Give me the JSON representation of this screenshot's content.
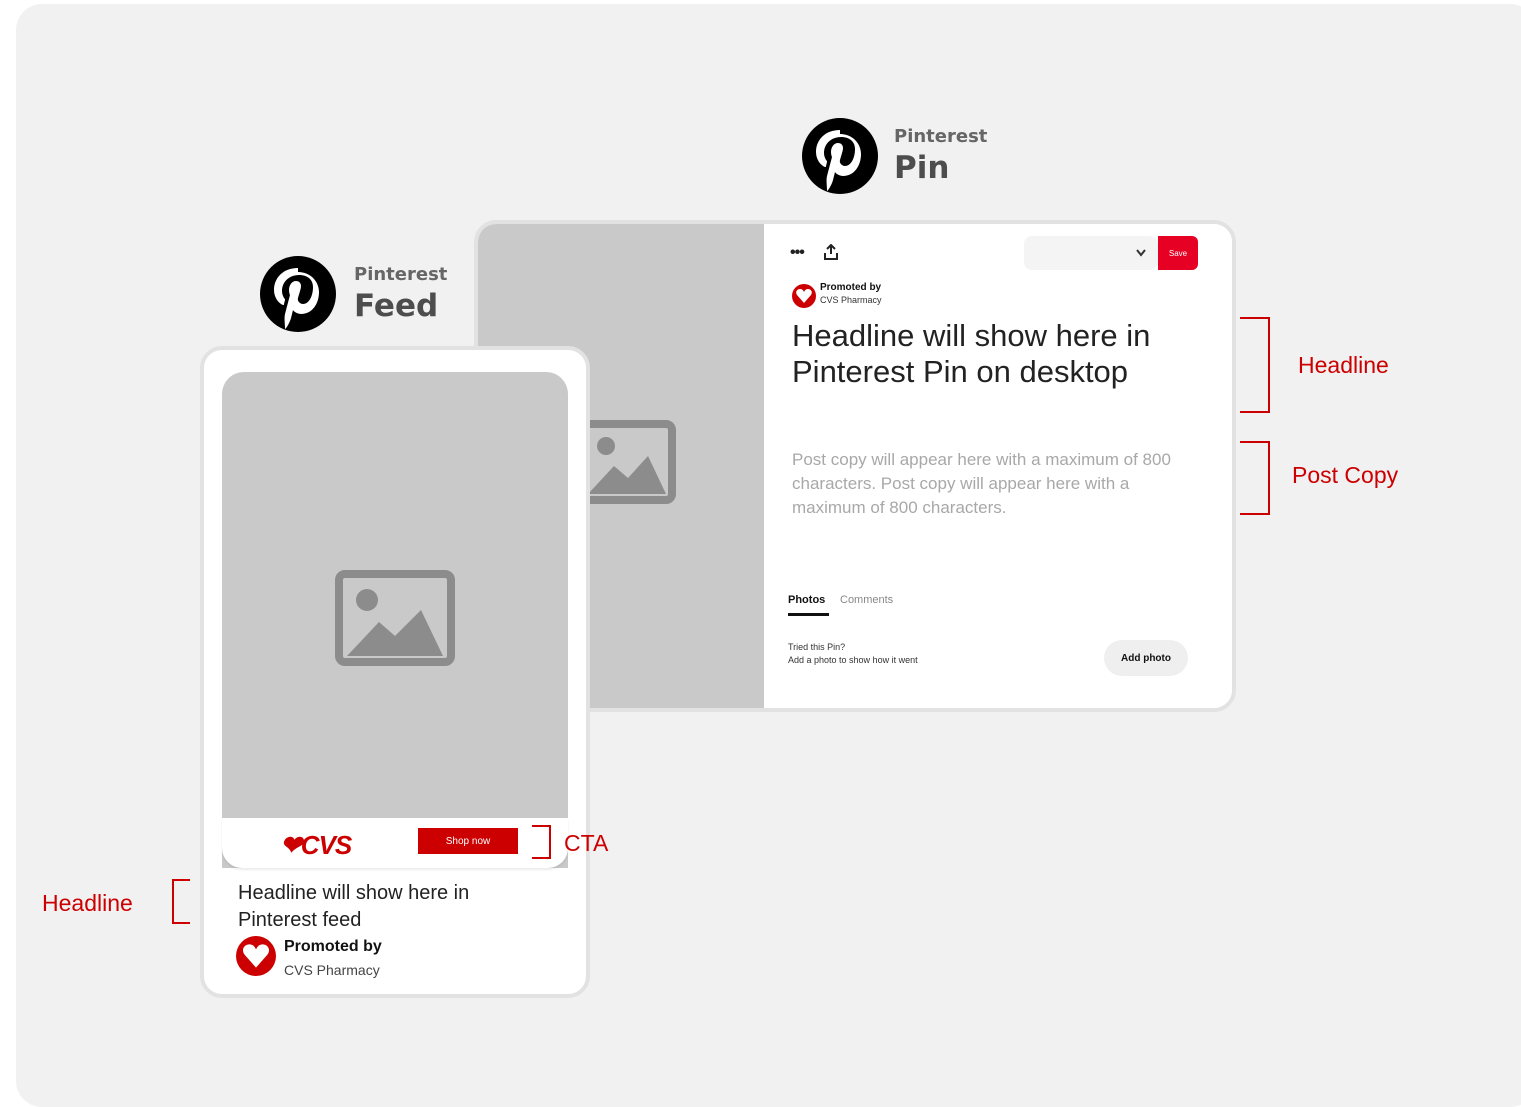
{
  "colors": {
    "brand_red": "#cc0000",
    "save_red": "#e60023",
    "placeholder_gray": "#c9c9c9"
  },
  "pin_header": {
    "small": "Pinterest",
    "big": "Pin"
  },
  "feed_header": {
    "small": "Pinterest",
    "big": "Feed"
  },
  "pin": {
    "dots": "•••",
    "save_label": "Save",
    "promoted_by": "Promoted by",
    "advertiser": "CVS Pharmacy",
    "headline": "Headline will show here in Pinterest Pin on desktop",
    "post_copy": "Post copy will appear here with a maximum of 800 characters. Post copy will appear here with a maximum of 800 characters.",
    "tabs": {
      "photos": "Photos",
      "comments": "Comments"
    },
    "tried_title": "Tried this Pin?",
    "tried_sub": "Add a photo to show how it went",
    "add_photo": "Add photo"
  },
  "feed": {
    "logo_text": "CVS",
    "cta_label": "Shop now",
    "headline": "Headline will show here in Pinterest feed",
    "promoted_by": "Promoted by",
    "advertiser": "CVS Pharmacy"
  },
  "annotations": {
    "pin_headline": "Headline",
    "pin_post_copy": "Post Copy",
    "feed_cta": "CTA",
    "feed_headline": "Headline"
  },
  "icons": [
    "pinterest-logo-icon",
    "more-icon",
    "share-icon",
    "chevron-down-icon",
    "image-placeholder-icon",
    "cvs-heart-icon"
  ]
}
